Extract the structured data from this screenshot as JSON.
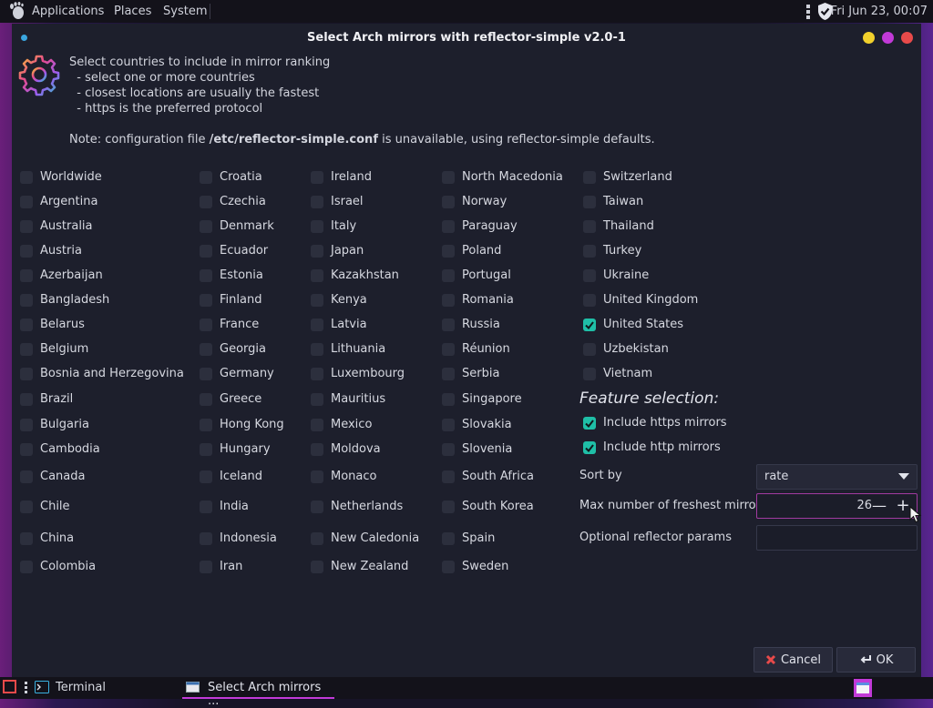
{
  "top_panel": {
    "menus": [
      "Applications",
      "Places",
      "System"
    ],
    "clock": "Fri Jun 23, 00:07"
  },
  "window": {
    "title": "Select Arch mirrors with reflector-simple v2.0-1",
    "controls": {
      "minimize_color": "#f1d02c",
      "maximize_color": "#c23ad8",
      "close_color": "#e84a4a"
    }
  },
  "header": {
    "lines": [
      "Select countries to include in mirror ranking",
      "  - select one or more countries",
      "  - closest locations are usually the fastest",
      "  - https is the preferred protocol"
    ],
    "note_prefix": "Note: configuration file ",
    "note_file": "/etc/reflector-simple.conf",
    "note_suffix": " is unavailable, using reflector-simple defaults."
  },
  "countries": {
    "col1": [
      {
        "label": "Worldwide",
        "checked": false
      },
      {
        "label": "Argentina",
        "checked": false
      },
      {
        "label": "Australia",
        "checked": false
      },
      {
        "label": "Austria",
        "checked": false
      },
      {
        "label": "Azerbaijan",
        "checked": false
      },
      {
        "label": "Bangladesh",
        "checked": false
      },
      {
        "label": "Belarus",
        "checked": false
      },
      {
        "label": "Belgium",
        "checked": false
      },
      {
        "label": "Bosnia and Herzegovina",
        "checked": false
      },
      {
        "label": "Brazil",
        "checked": false
      },
      {
        "label": "Bulgaria",
        "checked": false
      },
      {
        "label": "Cambodia",
        "checked": false
      },
      {
        "label": "Canada",
        "checked": false
      },
      {
        "label": "Chile",
        "checked": false
      },
      {
        "label": "China",
        "checked": false
      },
      {
        "label": "Colombia",
        "checked": false
      }
    ],
    "col2": [
      {
        "label": "Croatia",
        "checked": false
      },
      {
        "label": "Czechia",
        "checked": false
      },
      {
        "label": "Denmark",
        "checked": false
      },
      {
        "label": "Ecuador",
        "checked": false
      },
      {
        "label": "Estonia",
        "checked": false
      },
      {
        "label": "Finland",
        "checked": false
      },
      {
        "label": "France",
        "checked": false
      },
      {
        "label": "Georgia",
        "checked": false
      },
      {
        "label": "Germany",
        "checked": false
      },
      {
        "label": "Greece",
        "checked": false
      },
      {
        "label": "Hong Kong",
        "checked": false
      },
      {
        "label": "Hungary",
        "checked": false
      },
      {
        "label": "Iceland",
        "checked": false
      },
      {
        "label": "India",
        "checked": false
      },
      {
        "label": "Indonesia",
        "checked": false
      },
      {
        "label": "Iran",
        "checked": false
      }
    ],
    "col3": [
      {
        "label": "Ireland",
        "checked": false
      },
      {
        "label": "Israel",
        "checked": false
      },
      {
        "label": "Italy",
        "checked": false
      },
      {
        "label": "Japan",
        "checked": false
      },
      {
        "label": "Kazakhstan",
        "checked": false
      },
      {
        "label": "Kenya",
        "checked": false
      },
      {
        "label": "Latvia",
        "checked": false
      },
      {
        "label": "Lithuania",
        "checked": false
      },
      {
        "label": "Luxembourg",
        "checked": false
      },
      {
        "label": "Mauritius",
        "checked": false
      },
      {
        "label": "Mexico",
        "checked": false
      },
      {
        "label": "Moldova",
        "checked": false
      },
      {
        "label": "Monaco",
        "checked": false
      },
      {
        "label": "Netherlands",
        "checked": false
      },
      {
        "label": "New Caledonia",
        "checked": false
      },
      {
        "label": "New Zealand",
        "checked": false
      }
    ],
    "col4": [
      {
        "label": "North Macedonia",
        "checked": false
      },
      {
        "label": "Norway",
        "checked": false
      },
      {
        "label": "Paraguay",
        "checked": false
      },
      {
        "label": "Poland",
        "checked": false
      },
      {
        "label": "Portugal",
        "checked": false
      },
      {
        "label": "Romania",
        "checked": false
      },
      {
        "label": "Russia",
        "checked": false
      },
      {
        "label": "Réunion",
        "checked": false
      },
      {
        "label": "Serbia",
        "checked": false
      },
      {
        "label": "Singapore",
        "checked": false
      },
      {
        "label": "Slovakia",
        "checked": false
      },
      {
        "label": "Slovenia",
        "checked": false
      },
      {
        "label": "South Africa",
        "checked": false
      },
      {
        "label": "South Korea",
        "checked": false
      },
      {
        "label": "Spain",
        "checked": false
      },
      {
        "label": "Sweden",
        "checked": false
      }
    ],
    "col5": [
      {
        "label": "Switzerland",
        "checked": false
      },
      {
        "label": "Taiwan",
        "checked": false
      },
      {
        "label": "Thailand",
        "checked": false
      },
      {
        "label": "Turkey",
        "checked": false
      },
      {
        "label": "Ukraine",
        "checked": false
      },
      {
        "label": "United Kingdom",
        "checked": false
      },
      {
        "label": "United States",
        "checked": true
      },
      {
        "label": "Uzbekistan",
        "checked": false
      },
      {
        "label": "Vietnam",
        "checked": false
      }
    ]
  },
  "features": {
    "title": "Feature selection:",
    "https": {
      "label": "Include https mirrors",
      "checked": true
    },
    "http": {
      "label": "Include http mirrors",
      "checked": true
    },
    "sort_label": "Sort by",
    "sort_value": "rate",
    "max_label": "Max number of freshest mirrors",
    "max_value": "26",
    "params_label": "Optional reflector params",
    "params_value": ""
  },
  "buttons": {
    "cancel": "Cancel",
    "ok": "OK"
  },
  "taskbar": {
    "terminal": "Terminal",
    "active_window": "Select Arch mirrors ..."
  },
  "colors": {
    "accent": "#1fbfa7",
    "highlight": "#a13aa0"
  }
}
